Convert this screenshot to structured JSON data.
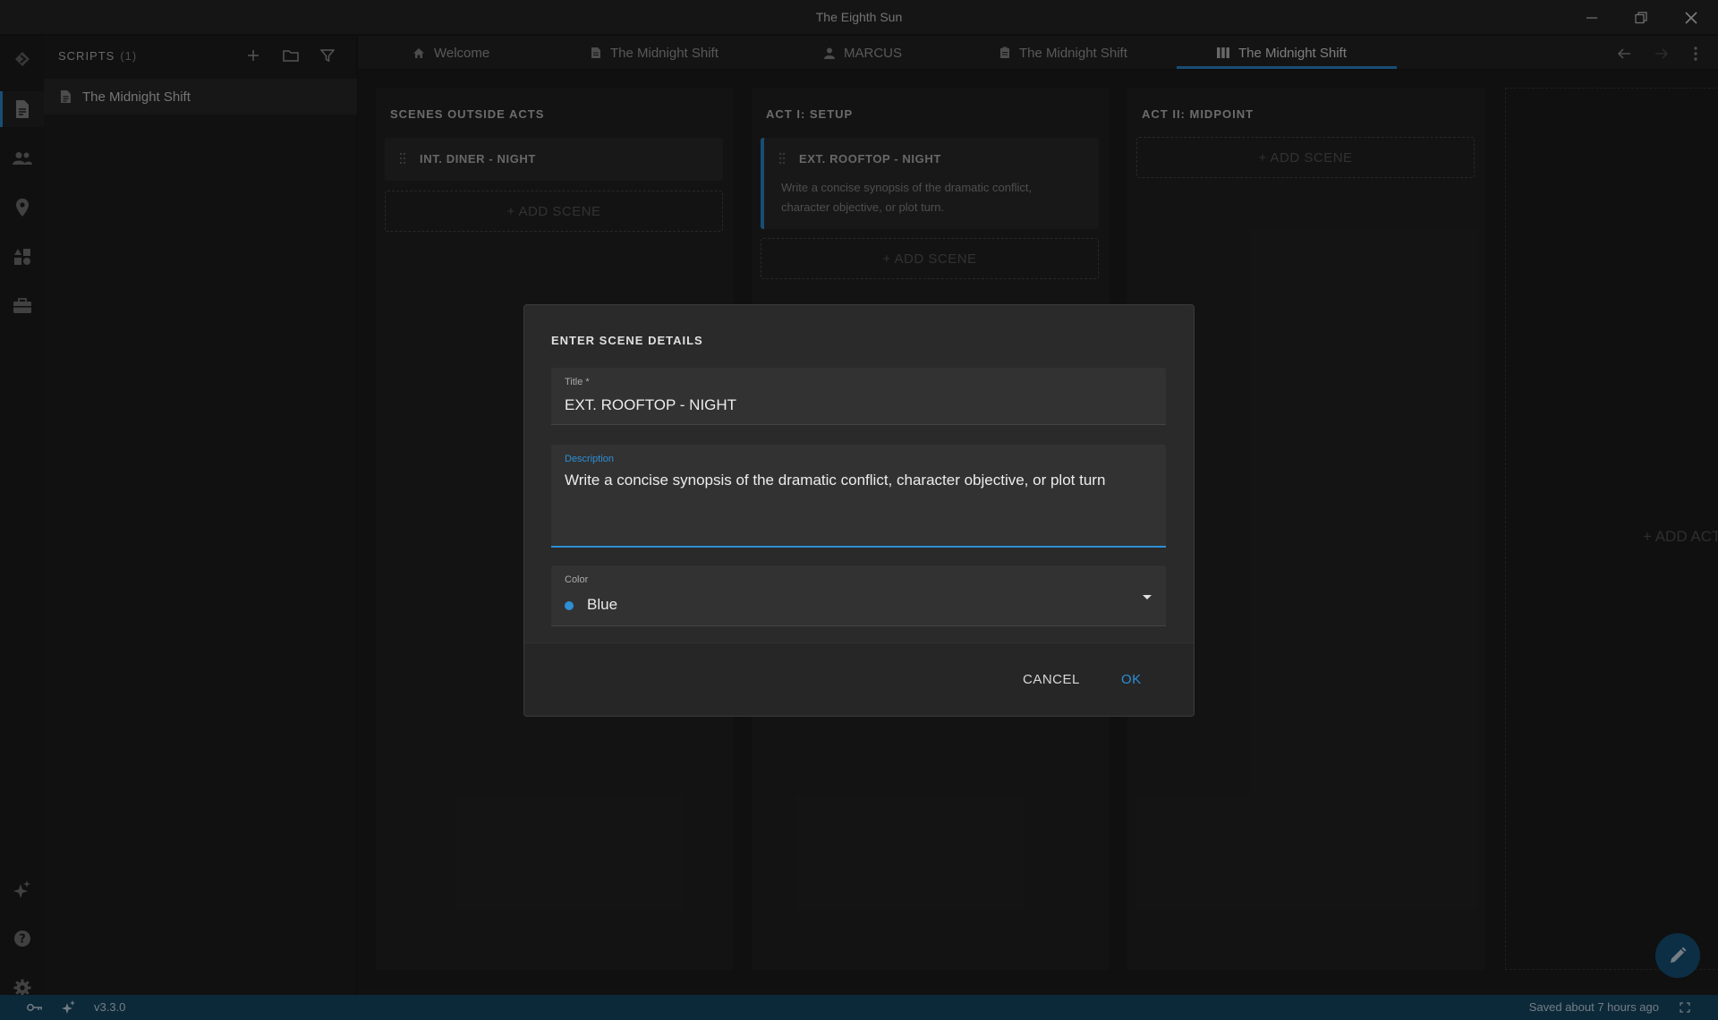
{
  "window": {
    "title": "The Eighth Sun"
  },
  "sidebar": {
    "header_label": "SCRIPTS",
    "count": "(1)",
    "items": [
      {
        "label": "The Midnight Shift",
        "icon": "document-icon"
      }
    ]
  },
  "tabs": [
    {
      "label": "Welcome",
      "icon": "home-icon"
    },
    {
      "label": "The Midnight Shift",
      "icon": "document-icon"
    },
    {
      "label": "MARCUS",
      "icon": "person-icon"
    },
    {
      "label": "The Midnight Shift",
      "icon": "notes-icon"
    },
    {
      "label": "The Midnight Shift",
      "icon": "board-icon",
      "active": true
    }
  ],
  "board": {
    "columns": [
      {
        "title": "SCENES OUTSIDE ACTS",
        "cards": [
          {
            "title": "INT. DINER - NIGHT",
            "description": ""
          }
        ],
        "add_label": "+ ADD SCENE"
      },
      {
        "title": "ACT I: SETUP",
        "cards": [
          {
            "title": "EXT. ROOFTOP - NIGHT",
            "description": "Write a concise synopsis of the dramatic conflict, character objective, or plot turn."
          }
        ],
        "add_label": "+ ADD SCENE"
      },
      {
        "title": "ACT II: MIDPOINT",
        "cards": [],
        "add_label": "+ ADD SCENE"
      }
    ],
    "add_act_label": "+ ADD ACT"
  },
  "dialog": {
    "title": "ENTER SCENE DETAILS",
    "title_field": {
      "label": "Title *",
      "value": "EXT. ROOFTOP - NIGHT"
    },
    "description_field": {
      "label": "Description",
      "value": "Write a concise synopsis of the dramatic conflict, character objective, or plot turn"
    },
    "color_field": {
      "label": "Color",
      "value": "Blue",
      "swatch": "#2d8fd5"
    },
    "cancel_label": "CANCEL",
    "ok_label": "OK"
  },
  "statusbar": {
    "version": "v3.3.0",
    "saved": "Saved about 7 hours ago"
  },
  "colors": {
    "accent": "#2d8fd5",
    "statusbar": "#174b6b"
  }
}
